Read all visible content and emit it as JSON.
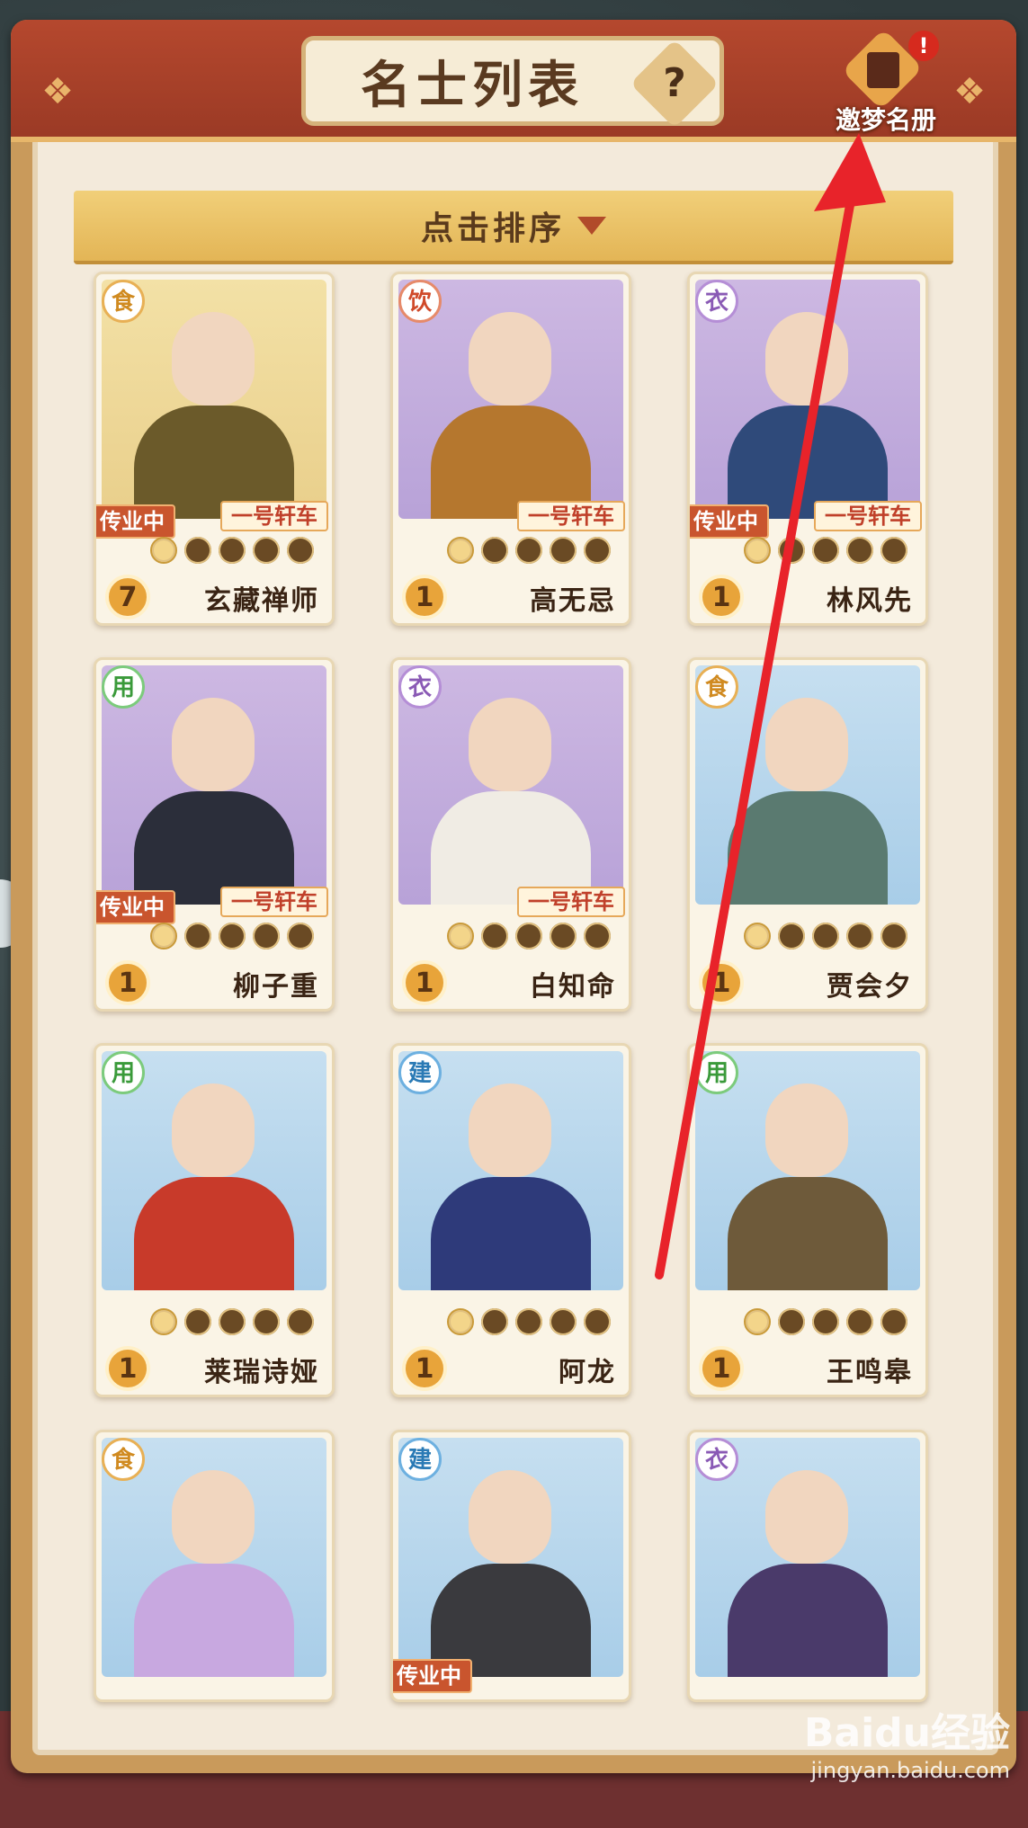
{
  "header": {
    "title": "名士列表",
    "help_glyph": "?",
    "book_label": "邀梦名册",
    "book_alert": "!"
  },
  "sort": {
    "label": "点击排序"
  },
  "cards": [
    {
      "name": "玄藏禅师",
      "type": "食",
      "level": "7",
      "car": "一号轩车",
      "training": "传业中",
      "bg": "gold",
      "badge": "b-food",
      "body": "#6b5a2a"
    },
    {
      "name": "高无忌",
      "type": "饮",
      "level": "1",
      "car": "一号轩车",
      "training": "",
      "bg": "purple",
      "badge": "b-drink",
      "body": "#b5772e"
    },
    {
      "name": "林风先",
      "type": "衣",
      "level": "1",
      "car": "一号轩车",
      "training": "传业中",
      "bg": "purple",
      "badge": "b-cloth",
      "body": "#2f4a7a"
    },
    {
      "name": "柳子重",
      "type": "用",
      "level": "1",
      "car": "一号轩车",
      "training": "传业中",
      "bg": "purple",
      "badge": "b-use",
      "body": "#2b2e3a"
    },
    {
      "name": "白知命",
      "type": "衣",
      "level": "1",
      "car": "一号轩车",
      "training": "",
      "bg": "purple",
      "badge": "b-cloth",
      "body": "#f0ece4"
    },
    {
      "name": "贾会夕",
      "type": "食",
      "level": "1",
      "car": "",
      "training": "",
      "bg": "blue",
      "badge": "b-food",
      "body": "#5a7a70"
    },
    {
      "name": "莱瑞诗娅",
      "type": "用",
      "level": "1",
      "car": "",
      "training": "",
      "bg": "blue",
      "badge": "b-use",
      "body": "#c83a2a"
    },
    {
      "name": "阿龙",
      "type": "建",
      "level": "1",
      "car": "",
      "training": "",
      "bg": "blue",
      "badge": "b-build",
      "body": "#2e3a7a"
    },
    {
      "name": "王鸣皋",
      "type": "用",
      "level": "1",
      "car": "",
      "training": "",
      "bg": "blue",
      "badge": "b-use",
      "body": "#6e5a3a"
    },
    {
      "name": "",
      "type": "食",
      "level": "",
      "car": "",
      "training": "",
      "bg": "blue",
      "badge": "b-food",
      "body": "#c8a8e0"
    },
    {
      "name": "",
      "type": "建",
      "level": "",
      "car": "",
      "training": "传业中",
      "bg": "blue",
      "badge": "b-build",
      "body": "#3a3a3e"
    },
    {
      "name": "",
      "type": "衣",
      "level": "",
      "car": "",
      "training": "",
      "bg": "blue",
      "badge": "b-cloth",
      "body": "#4a3a6a"
    }
  ],
  "watermark": {
    "main": "Baidu经验",
    "sub": "jingyan.baidu.com"
  }
}
